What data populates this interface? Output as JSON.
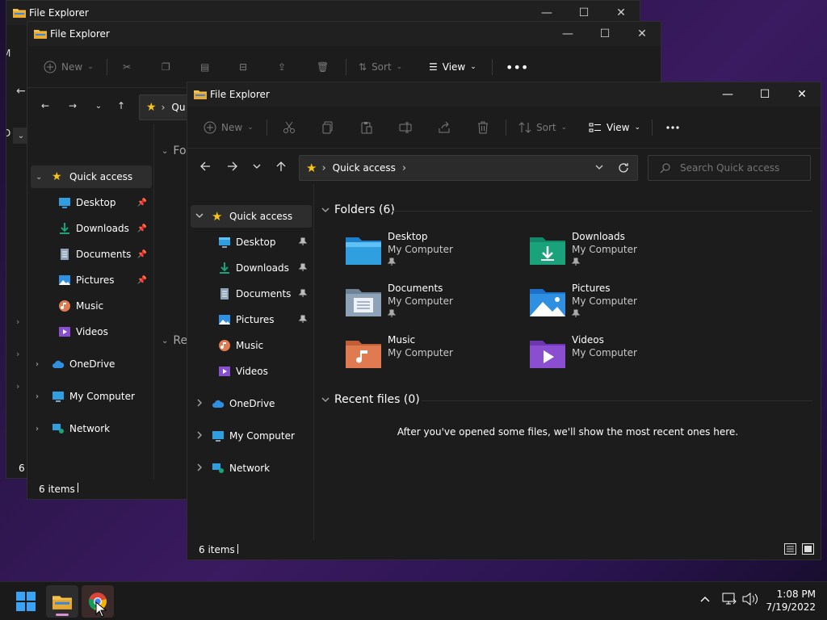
{
  "window_title": "File Explorer",
  "toolbar": {
    "new_label": "New",
    "sort_label": "Sort",
    "view_label": "View"
  },
  "address": {
    "current": "Quick access",
    "current_short": "Qu"
  },
  "search": {
    "placeholder": "Search Quick access"
  },
  "sidebar": {
    "quick_access": "Quick access",
    "pinned": [
      {
        "label": "Desktop",
        "icon": "desktop-icon"
      },
      {
        "label": "Downloads",
        "icon": "downloads-icon"
      },
      {
        "label": "Documents",
        "icon": "documents-icon"
      },
      {
        "label": "Pictures",
        "icon": "pictures-icon"
      }
    ],
    "music": "Music",
    "videos": "Videos",
    "onedrive": "OneDrive",
    "my_computer": "My Computer",
    "network": "Network"
  },
  "folders_section": {
    "heading": "Folders (6)",
    "heading_short": "Fo",
    "items": [
      {
        "name": "Desktop",
        "location": "My Computer",
        "pinned": true,
        "color": "#2f9fe0"
      },
      {
        "name": "Downloads",
        "location": "My Computer",
        "pinned": true,
        "color": "#1aa37a"
      },
      {
        "name": "Documents",
        "location": "My Computer",
        "pinned": true,
        "color": "#8fa3b8"
      },
      {
        "name": "Pictures",
        "location": "My Computer",
        "pinned": true,
        "color": "#2f8fe0"
      },
      {
        "name": "Music",
        "location": "My Computer",
        "pinned": false,
        "color": "#e07a50"
      },
      {
        "name": "Videos",
        "location": "My Computer",
        "pinned": false,
        "color": "#8a4fd0"
      }
    ]
  },
  "recent_section": {
    "heading": "Recent files (0)",
    "heading_short": "Re",
    "empty_message": "After you've opened some files, we'll show the most recent ones here."
  },
  "status": {
    "items": "6 items",
    "items_short": "6 i"
  },
  "back_window_fragments": {
    "menu_letter": "M",
    "sidebar_letter": "D"
  },
  "taskbar": {
    "time": "1:08 PM",
    "date": "7/19/2022"
  },
  "colors": {
    "accent": "#0078d4",
    "folder_yellow": "#f2c14e",
    "star": "#f5c518"
  }
}
